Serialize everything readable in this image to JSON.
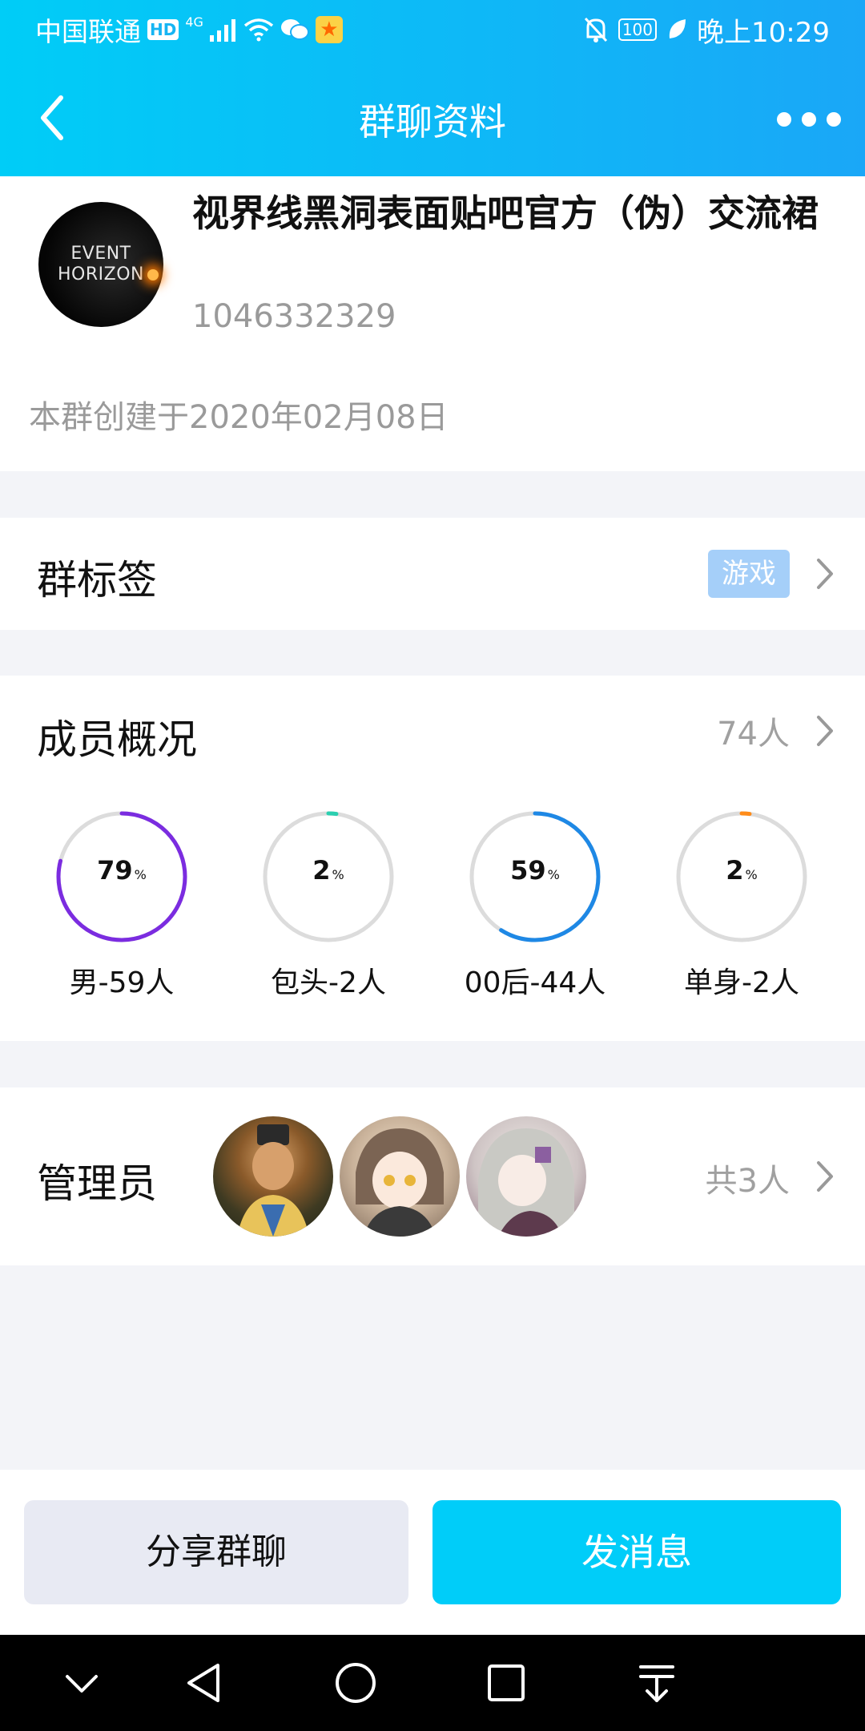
{
  "status_bar": {
    "carrier": "中国联通",
    "network_badge": "HD",
    "network_type": "4G",
    "battery": "100",
    "time": "晚上10:29"
  },
  "nav": {
    "title": "群聊资料",
    "back_icon": "chevron-left-icon",
    "more_icon": "more-icon"
  },
  "group": {
    "avatar_text_line1": "EVENT",
    "avatar_text_line2": "HORIZON",
    "name": "视界线黑洞表面贴吧官方（伪）交流裙",
    "id": "1046332329",
    "created": "本群创建于2020年02月08日"
  },
  "tags": {
    "label": "群标签",
    "value": "游戏"
  },
  "members": {
    "label": "成员概况",
    "count": "74人",
    "stats": [
      {
        "value": "79",
        "unit": "%",
        "label": "男-59人",
        "percent": 79,
        "color": "#7b2ce0"
      },
      {
        "value": "2",
        "unit": "%",
        "label": "包头-2人",
        "percent": 2,
        "color": "#2bcfb0"
      },
      {
        "value": "59",
        "unit": "%",
        "label": "00后-44人",
        "percent": 59,
        "color": "#1e88e5"
      },
      {
        "value": "2",
        "unit": "%",
        "label": "单身-2人",
        "percent": 2,
        "color": "#ff8c1a"
      }
    ]
  },
  "admins": {
    "label": "管理员",
    "total": "共3人"
  },
  "footer": {
    "share_label": "分享群聊",
    "send_label": "发消息"
  },
  "colors": {
    "accent": "#00cdf9",
    "header_gradient_start": "#00cdf7",
    "header_gradient_end": "#1aa7f7",
    "tag_badge": "#a5cff9"
  }
}
